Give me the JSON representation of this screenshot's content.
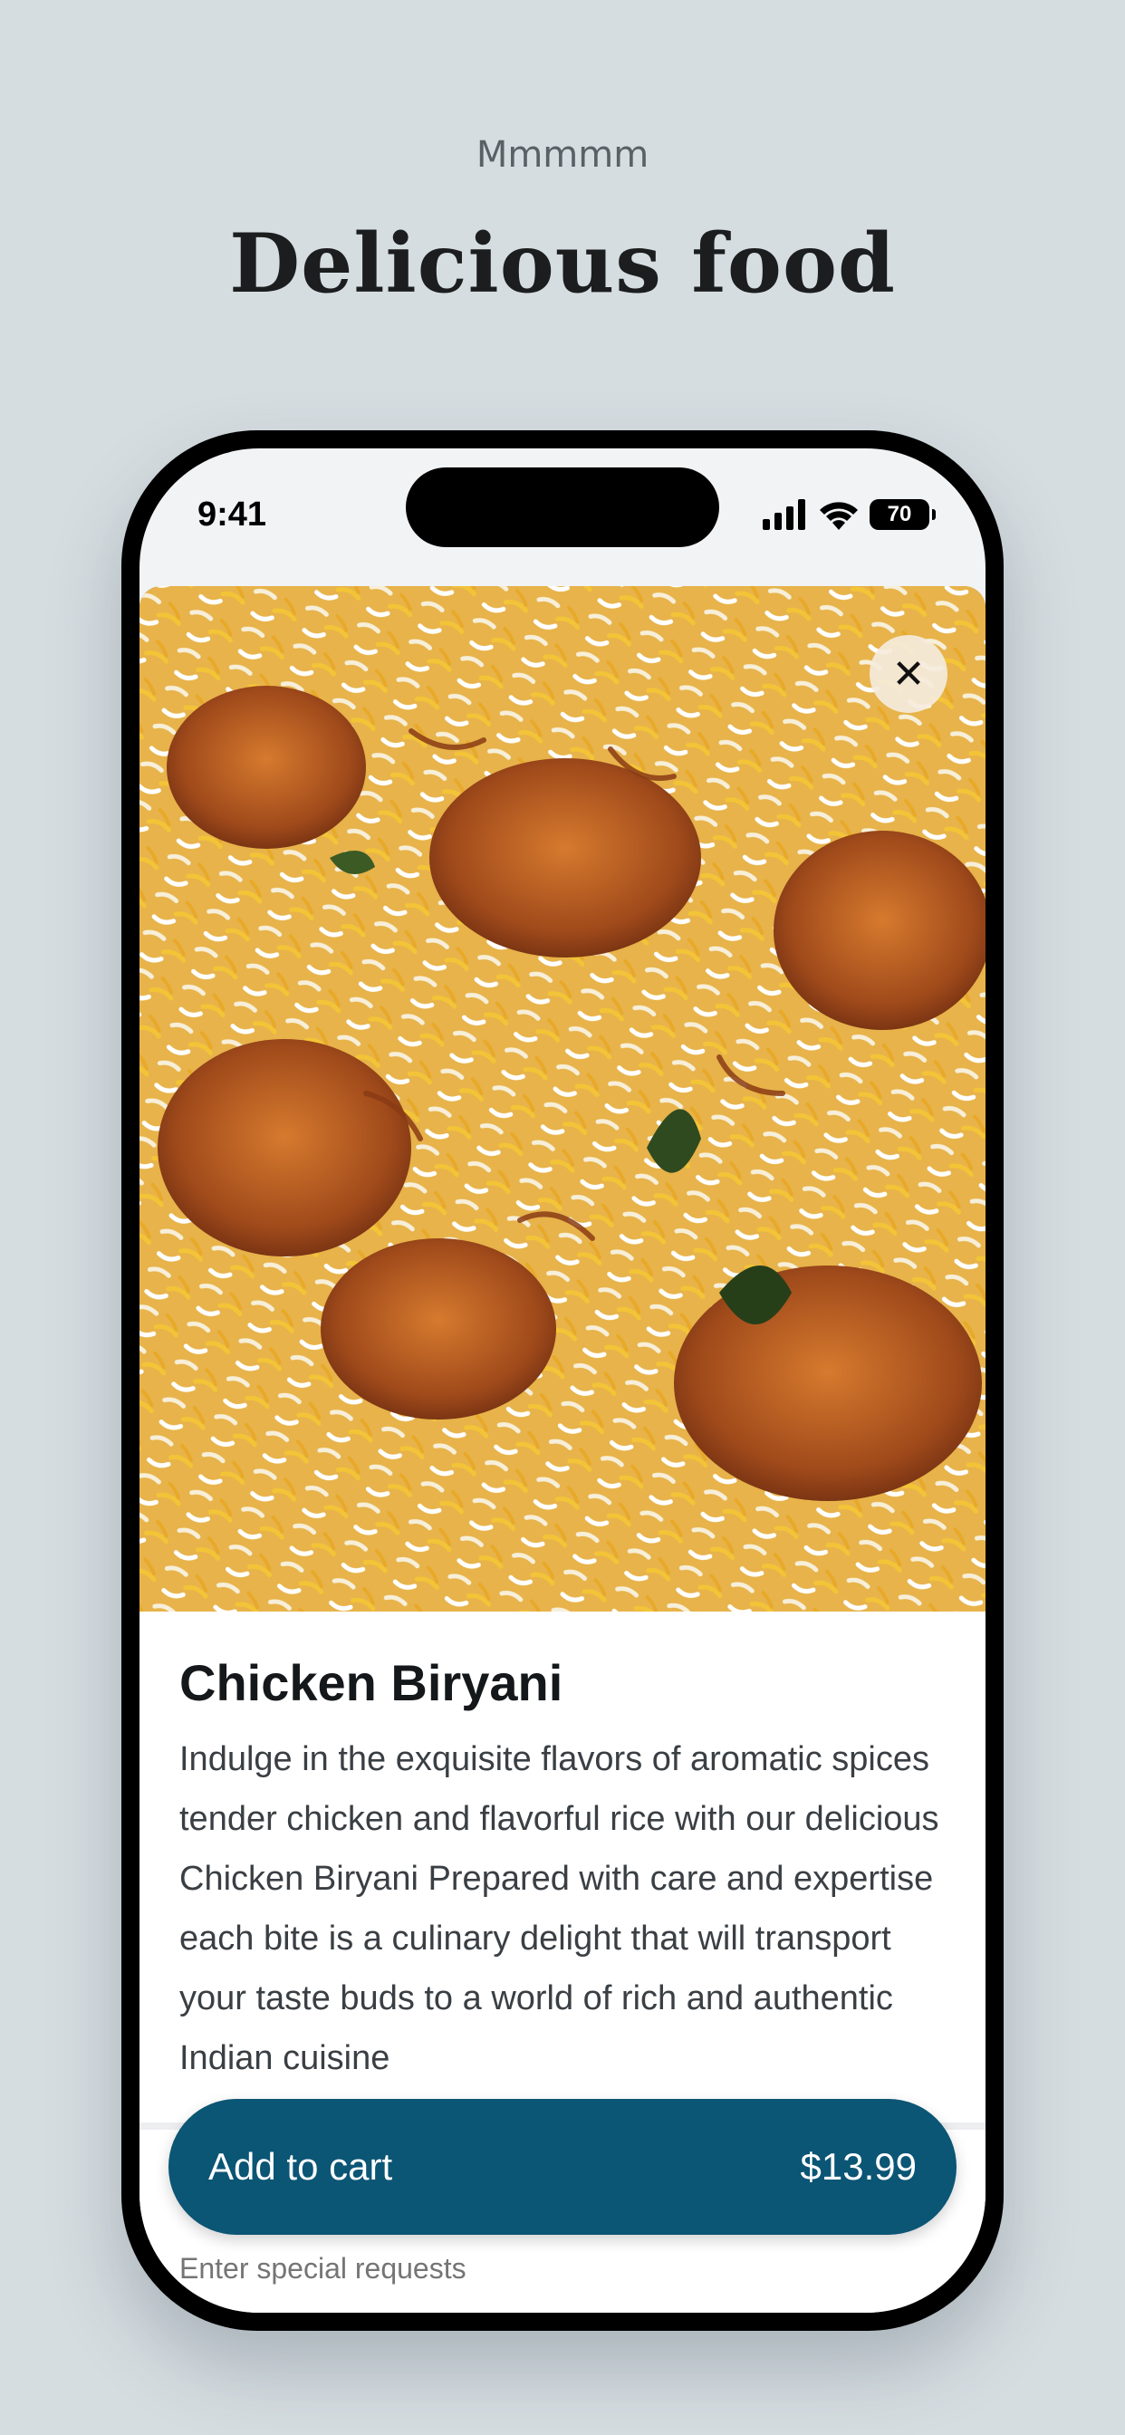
{
  "page": {
    "eyebrow": "Mmmmm",
    "headline": "Delicious food"
  },
  "status_bar": {
    "time": "9:41",
    "battery": "70"
  },
  "item": {
    "name": "Chicken Biryani",
    "description": "Indulge in the exquisite flavors of aromatic spices tender chicken and flavorful rice with our delicious Chicken Biryani Prepared with care and expertise each bite is a culinary delight that will transport your taste buds to a world of rich and authentic Indian cuisine",
    "notes_placeholder": "Enter special requests"
  },
  "cart": {
    "label": "Add to cart",
    "price": "$13.99"
  },
  "icons": {
    "close": "close-icon",
    "signal": "signal-icon",
    "wifi": "wifi-icon",
    "battery": "battery-icon"
  },
  "colors": {
    "background": "#d6dde1",
    "accent": "#0b5575"
  }
}
